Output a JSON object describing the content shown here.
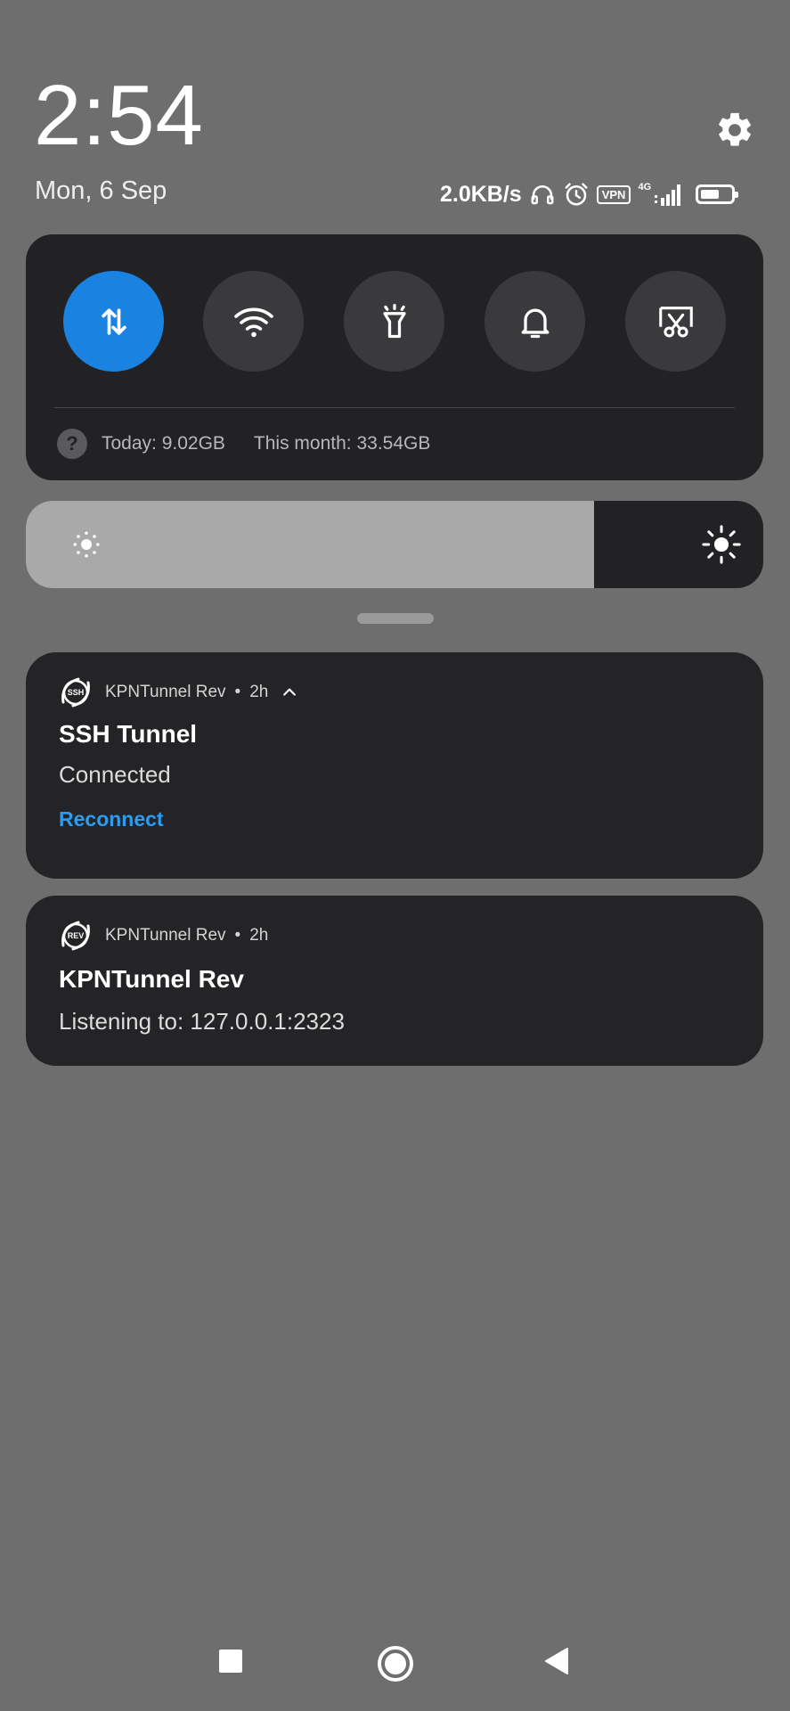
{
  "status": {
    "time": "2:54",
    "date": "Mon, 6 Sep",
    "net_speed": "2.0KB/s",
    "vpn_label": "VPN",
    "network_type": "4G"
  },
  "quick_settings": {
    "tiles": [
      {
        "name": "mobile-data",
        "icon": "data-arrows-icon",
        "active": true
      },
      {
        "name": "wifi",
        "icon": "wifi-icon",
        "active": false
      },
      {
        "name": "flashlight",
        "icon": "flashlight-icon",
        "active": false
      },
      {
        "name": "sound",
        "icon": "bell-icon",
        "active": false
      },
      {
        "name": "screenshot",
        "icon": "scissors-icon",
        "active": false
      }
    ],
    "help_glyph": "?",
    "usage_today": "Today: 9.02GB",
    "usage_month": "This month: 33.54GB",
    "active_color": "#1a82e0"
  },
  "brightness": {
    "level": 0.77
  },
  "notifications": [
    {
      "app_icon_text": "SSH",
      "app_name": "KPNTunnel Rev",
      "separator": "•",
      "time": "2h",
      "title": "SSH Tunnel",
      "text": "Connected",
      "action": "Reconnect"
    },
    {
      "app_icon_text": "REV",
      "app_name": "KPNTunnel Rev",
      "separator": "•",
      "time": "2h",
      "title": "KPNTunnel Rev",
      "text": "Listening to: 127.0.0.1:2323"
    }
  ],
  "colors": {
    "background": "#6e6e6e",
    "panel": "#222225",
    "accent": "#1a82e0",
    "action": "#2d9cf0"
  }
}
